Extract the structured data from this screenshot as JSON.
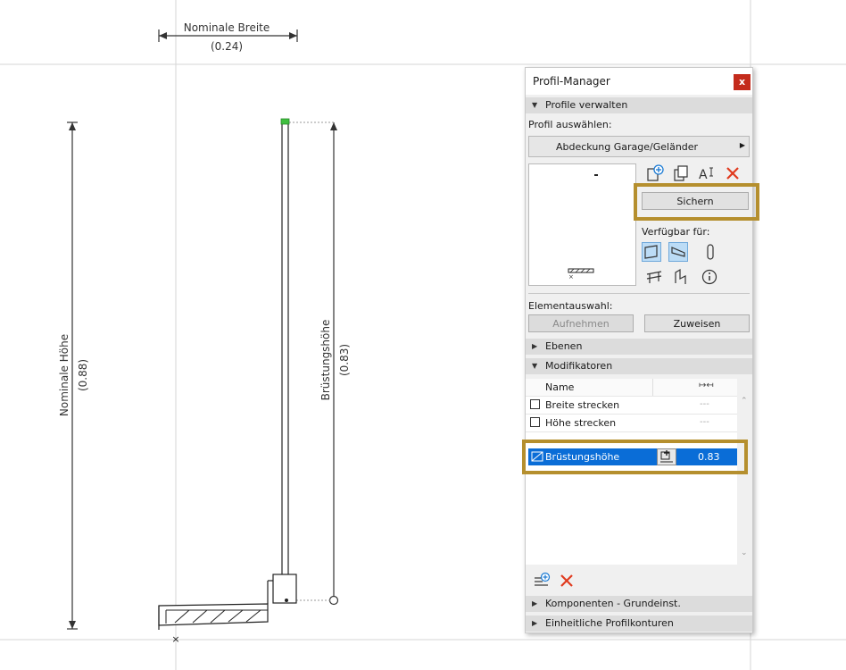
{
  "drawing": {
    "nominal_width_label": "Nominale Breite",
    "nominal_width_value": "(0.24)",
    "nominal_height_label": "Nominale Höhe",
    "nominal_height_value": "(0.88)",
    "parapet_height_label": "Brüstungshöhe",
    "parapet_height_value": "(0.83)"
  },
  "panel": {
    "title": "Profil-Manager",
    "close_label": "x",
    "section_manage": "Profile verwalten",
    "select_profile_label": "Profil auswählen:",
    "selected_profile": "Abdeckung Garage/Geländer",
    "save_label": "Sichern",
    "available_for_label": "Verfügbar für:",
    "element_selection_label": "Elementauswahl:",
    "pick_label": "Aufnehmen",
    "assign_label": "Zuweisen",
    "section_layers": "Ebenen",
    "section_modifiers": "Modifikatoren",
    "table_header_name": "Name",
    "rows": [
      {
        "name": "Breite strecken",
        "value": "---"
      },
      {
        "name": "Höhe strecken",
        "value": "---"
      }
    ],
    "selected_row": {
      "name": "Brüstungshöhe",
      "value": "0.83"
    },
    "section_components": "Komponenten - Grundeinst.",
    "section_contours": "Einheitliche Profilkonturen"
  }
}
